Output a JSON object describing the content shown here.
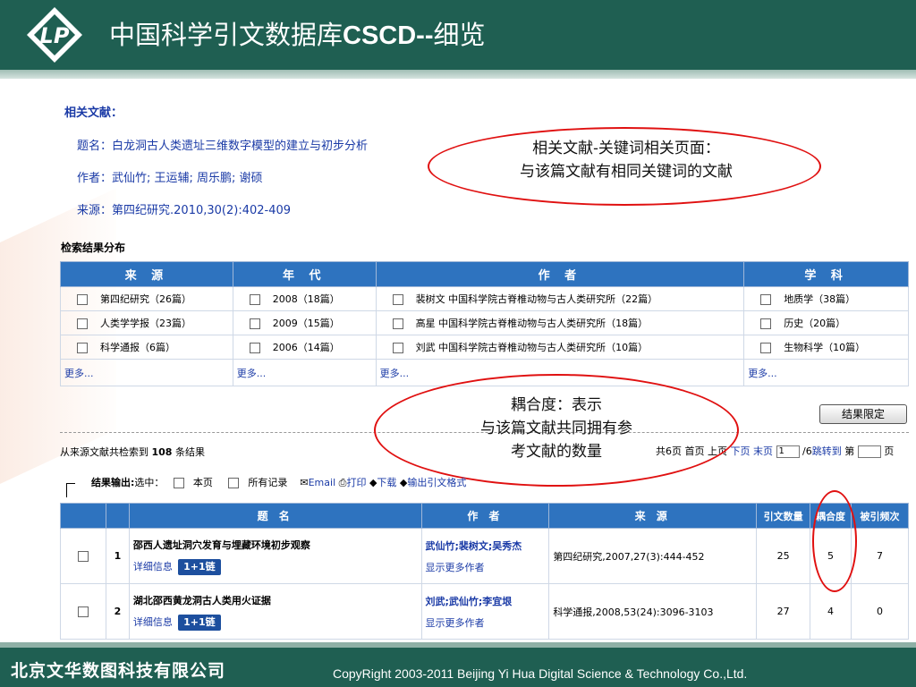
{
  "header": {
    "title_cn_prefix": "中国科学引文数据库",
    "title_brand": "CSCD--",
    "title_cn_suffix": "细览"
  },
  "related": {
    "heading": "相关文献：",
    "title_label": "题名：",
    "title_value": "白龙洞古人类遗址三维数字模型的建立与初步分析",
    "author_label": "作者：",
    "author_value": "武仙竹; 王运辅; 周乐鹏; 谢硕",
    "source_label": "来源：",
    "source_value": "第四纪研究.2010,30(2):402-409"
  },
  "annotations": {
    "keyword_line1": "相关文献-关键词相关页面：",
    "keyword_line2": "与该篇文献有相同关键词的文献",
    "coupling_line1": "耦合度：表示",
    "coupling_line2": "与该篇文献共同拥有参",
    "coupling_line3": "考文献的数量"
  },
  "distribution": {
    "title": "检索结果分布",
    "headers": [
      "来 源",
      "年 代",
      "作 者",
      "学 科"
    ],
    "rows": [
      [
        "第四纪研究（26篇）",
        "2008（18篇）",
        "裴树文  中国科学院古脊椎动物与古人类研究所（22篇）",
        "地质学（38篇）"
      ],
      [
        "人类学学报（23篇）",
        "2009（15篇）",
        "高星  中国科学院古脊椎动物与古人类研究所（18篇）",
        "历史（20篇）"
      ],
      [
        "科学通报（6篇）",
        "2006（14篇）",
        "刘武  中国科学院古脊椎动物与古人类研究所（10篇）",
        "生物科学（10篇）"
      ]
    ],
    "more": [
      "更多...",
      "更多...",
      "更多...",
      "更多..."
    ],
    "limit_button": "结果限定"
  },
  "summary": {
    "count_prefix": "从来源文献共检索到",
    "count": "108",
    "count_suffix": "条结果"
  },
  "pager": {
    "total": "共6页",
    "first": "首页",
    "prev": "上页",
    "next": "下页",
    "last": "末页",
    "current": "1",
    "of_total": "/6",
    "goto": "跳转到",
    "page_prefix": "第",
    "page_suffix": "页"
  },
  "output": {
    "label": "结果输出:",
    "select_label": "选中：",
    "this_page": "本页",
    "all_records": "所有记录",
    "email": "Email",
    "print": "打印",
    "download": "下载",
    "export": "输出引文格式"
  },
  "results": {
    "headers": [
      "",
      "",
      "题 名",
      "作 者",
      "来 源",
      "引文数量",
      "耦合度",
      "被引频次"
    ],
    "detail_label": "详细信息",
    "link_badge": "1+1链",
    "more_authors": "显示更多作者",
    "rows": [
      {
        "no": "1",
        "title": "邵西人遗址洞穴发育与埋藏环境初步观察",
        "authors": "武仙竹;裴树文;吴秀杰",
        "source": "第四纪研究,2007,27(3):444-452",
        "refs": "25",
        "coupling": "5",
        "cited": "7"
      },
      {
        "no": "2",
        "title": "湖北邵西黄龙洞古人类用火证据",
        "authors": "刘武;武仙竹;李宜垠",
        "source": "科学通报,2008,53(24):3096-3103",
        "refs": "27",
        "coupling": "4",
        "cited": "0"
      }
    ]
  },
  "footer": {
    "company": "北京文华数图科技有限公司",
    "copyright": "CopyRight 2003-2011 Beijing Yi Hua Digital Science & Technology Co.,Ltd."
  }
}
